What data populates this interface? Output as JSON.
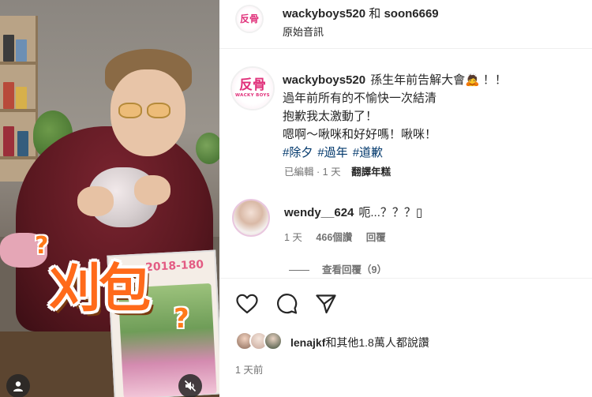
{
  "media": {
    "sticker_text": "刈包",
    "qmarks": [
      "?",
      "?"
    ],
    "poster_text": "2018-180"
  },
  "header": {
    "author": "wackyboys520",
    "joiner": "和",
    "coauthor": "soon6669",
    "audio": "原始音訊",
    "avatar_logo_big": "反骨",
    "avatar_logo_small": "WACKY BOYS"
  },
  "caption": {
    "username": "wackyboys520",
    "lines": [
      "孫生年前告解大會🙇 ！！",
      "過年前所有的不愉快一次結清",
      "抱歉我太激動了！",
      "嗯啊～啾咪和好好嗎！啾咪！"
    ],
    "hashtags": [
      "#除夕",
      "#過年",
      "#道歉"
    ],
    "edited": "已編輯",
    "dot": "·",
    "time": "1 天",
    "translate": "翻譯年糕"
  },
  "comment": {
    "username": "wendy__624",
    "text": "呃...？？？▯",
    "time": "1 天",
    "likes": "466個讚",
    "reply": "回覆",
    "view_replies": "查看回覆（9）"
  },
  "icons": {
    "like": "heart-icon",
    "comment": "comment-icon",
    "share": "share-icon",
    "mute": "muted-speaker-icon",
    "user_tags": "user-icon"
  },
  "likes": {
    "user": "lenajkf",
    "rest": "和其他1.8萬人都說讚"
  },
  "post_time": "1 天前",
  "colors": {
    "accent_pink": "#e0307a",
    "hashtag": "#00376b",
    "secondary_text": "#737373",
    "sticker_orange": "#ff6a1a"
  }
}
